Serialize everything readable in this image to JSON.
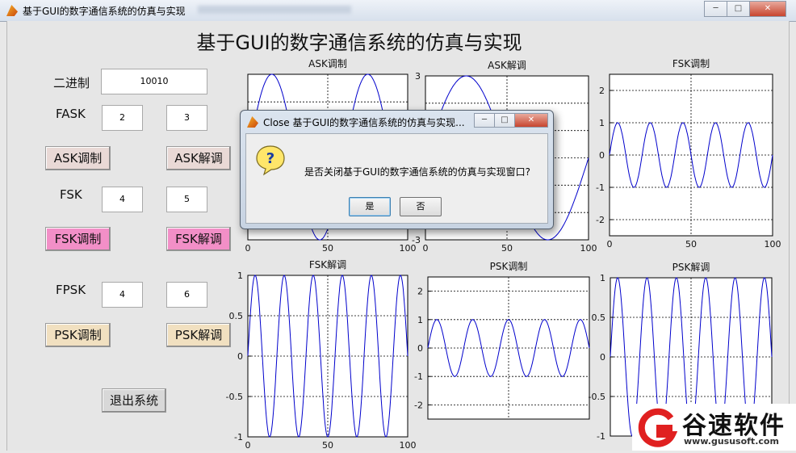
{
  "window": {
    "title": "基于GUI的数字通信系统的仿真与实现",
    "minimize": "─",
    "maximize": "□",
    "close": "✕"
  },
  "figure": {
    "main_title": "基于GUI的数字通信系统的仿真与实现"
  },
  "controls": {
    "binary_label": "二进制",
    "binary_value": "10010",
    "fask_label": "FASK",
    "fask_value1": "2",
    "fask_value2": "3",
    "ask_mod_button": "ASK调制",
    "ask_demod_button": "ASK解调",
    "fsk_label": "FSK",
    "fsk_value1": "4",
    "fsk_value2": "5",
    "fsk_mod_button": "FSK调制",
    "fsk_demod_button": "FSK解调",
    "fpsk_label": "FPSK",
    "fpsk_value1": "4",
    "fpsk_value2": "6",
    "psk_mod_button": "PSK调制",
    "psk_demod_button": "PSK解调",
    "exit_button": "退出系统"
  },
  "dialog": {
    "title": "Close 基于GUI的数字通信系统的仿真与实现...",
    "message": "是否关闭基于GUI的数字通信系统的仿真与实现窗口?",
    "yes_button": "是",
    "no_button": "否",
    "icon": "question-icon"
  },
  "watermark": {
    "brand": "谷速软件",
    "url": "www.gususoft.com"
  },
  "colors": {
    "curve": "#0000cc",
    "ask_button": "#e9d9d6",
    "fsk_button": "#f28fc7",
    "psk_button": "#f1e0c0",
    "watermark_red": "#e02020"
  },
  "chart_data": [
    {
      "type": "line",
      "title": "ASK调制",
      "xlim": [
        0,
        100
      ],
      "ylim": [
        -3,
        3
      ],
      "yticks": [],
      "xticks": [
        0,
        50,
        100
      ],
      "grid": true,
      "series": [
        {
          "function": "3*sin(2*pi*x/60)",
          "cycles_shown": 1.67
        }
      ]
    },
    {
      "type": "line",
      "title": "ASK解调",
      "xlim": [
        0,
        100
      ],
      "ylim": [
        -3,
        3
      ],
      "yticks": [
        3,
        -3
      ],
      "xticks": [
        0,
        50,
        100
      ],
      "grid": true,
      "series": [
        {
          "function": "3*sin(2*pi*x/100)",
          "cycles_shown": 1
        }
      ]
    },
    {
      "type": "line",
      "title": "FSK调制",
      "xlim": [
        0,
        100
      ],
      "ylim": [
        -2.5,
        2.5
      ],
      "yticks": [
        2,
        1,
        0,
        -1,
        -2
      ],
      "xticks": [
        0,
        50,
        100
      ],
      "grid": true,
      "series": [
        {
          "function": "sin",
          "cycles_shown": 5,
          "amplitude": 1
        }
      ]
    },
    {
      "type": "line",
      "title": "FSK解调",
      "xlim": [
        0,
        100
      ],
      "ylim": [
        -1,
        1
      ],
      "yticks": [
        1,
        0.5,
        0,
        -0.5,
        -1
      ],
      "xticks": [
        0,
        50,
        100
      ],
      "grid": true,
      "series": [
        {
          "function": "sin",
          "cycles_shown": 5.5,
          "amplitude": 1
        }
      ]
    },
    {
      "type": "line",
      "title": "PSK调制",
      "xlim": [
        0,
        100
      ],
      "ylim": [
        -2.5,
        2.5
      ],
      "yticks": [
        2,
        1,
        0,
        -1,
        -2
      ],
      "xticks": [],
      "grid": true,
      "series": [
        {
          "function": "sin",
          "cycles_shown": 4.5,
          "amplitude": 1
        }
      ]
    },
    {
      "type": "line",
      "title": "PSK解调",
      "xlim": [
        0,
        100
      ],
      "ylim": [
        -1,
        1
      ],
      "yticks": [
        1,
        0.5,
        0,
        -0.5,
        -1
      ],
      "xticks": [],
      "grid": true,
      "series": [
        {
          "function": "sin",
          "cycles_shown": 5.5,
          "amplitude": 1
        }
      ]
    }
  ]
}
